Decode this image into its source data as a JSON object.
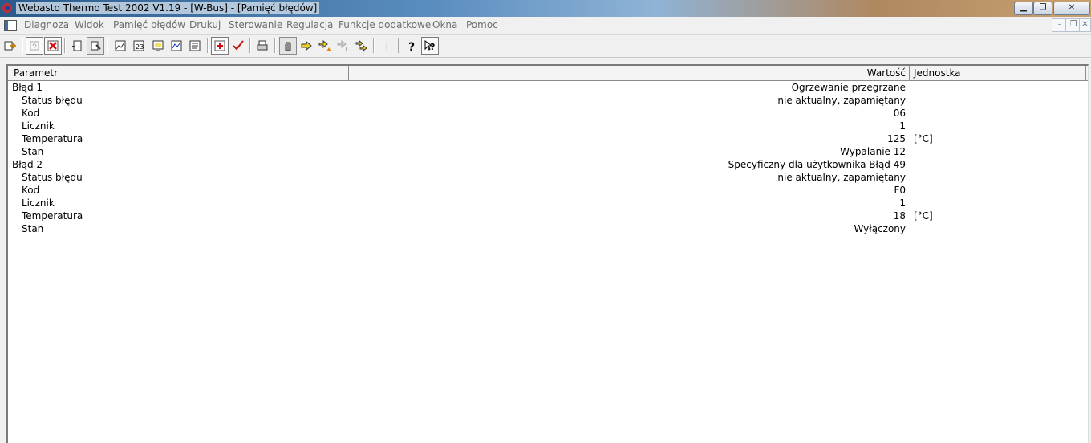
{
  "window": {
    "title": "Webasto Thermo Test 2002 V1.19 - [W-Bus] - [Pamięć błędów]",
    "minimize_glyph": "▁",
    "maximize_glyph": "❐",
    "close_glyph": "✕"
  },
  "menubar": {
    "items": [
      "Diagnoza",
      "Widok",
      "Pamięć błędów",
      "Drukuj",
      "Sterowanie",
      "Regulacja",
      "Funkcje dodatkowe",
      "Okna",
      "Pomoc"
    ],
    "mdi_minimize": "–",
    "mdi_restore": "❐",
    "mdi_close": "✕"
  },
  "toolbar": {
    "icons": [
      "connect-icon",
      "refresh-icon",
      "delete-icon",
      "read-icon",
      "clear-icon",
      "graph-icon",
      "calendar-icon",
      "display-icon",
      "chart-icon",
      "list-icon",
      "add-icon",
      "check-icon",
      "print-icon",
      "hand-icon",
      "arrow-icon",
      "arrow-warn-icon",
      "arrow-disabled-icon",
      "arrow-multi-icon",
      "blank-icon",
      "help-icon",
      "context-help-icon"
    ]
  },
  "table": {
    "headers": {
      "param": "Parametr",
      "value": "Wartość",
      "unit": "Jednostka"
    },
    "rows": [
      {
        "param": "Błąd 1",
        "value": "Ogrzewanie przegrzane",
        "unit": "",
        "indent": false
      },
      {
        "param": "Status błędu",
        "value": "nie aktualny, zapamiętany",
        "unit": "",
        "indent": true
      },
      {
        "param": "Kod",
        "value": "06",
        "unit": "",
        "indent": true
      },
      {
        "param": "Licznik",
        "value": "1",
        "unit": "",
        "indent": true
      },
      {
        "param": "Temperatura",
        "value": "125",
        "unit": "[°C]",
        "indent": true
      },
      {
        "param": "Stan",
        "value": "Wypalanie 12",
        "unit": "",
        "indent": true
      },
      {
        "param": "Błąd 2",
        "value": "Specyficzny dla użytkownika Błąd 49",
        "unit": "",
        "indent": false
      },
      {
        "param": "Status błędu",
        "value": "nie aktualny, zapamiętany",
        "unit": "",
        "indent": true
      },
      {
        "param": "Kod",
        "value": "F0",
        "unit": "",
        "indent": true
      },
      {
        "param": "Licznik",
        "value": "1",
        "unit": "",
        "indent": true
      },
      {
        "param": "Temperatura",
        "value": "18",
        "unit": "[°C]",
        "indent": true
      },
      {
        "param": "Stan",
        "value": "Wyłączony",
        "unit": "",
        "indent": true
      }
    ]
  },
  "colors": {
    "menu_text": "#6d6d6d",
    "header_bg": "#f4f4f4",
    "table_bg": "#ffffff"
  }
}
